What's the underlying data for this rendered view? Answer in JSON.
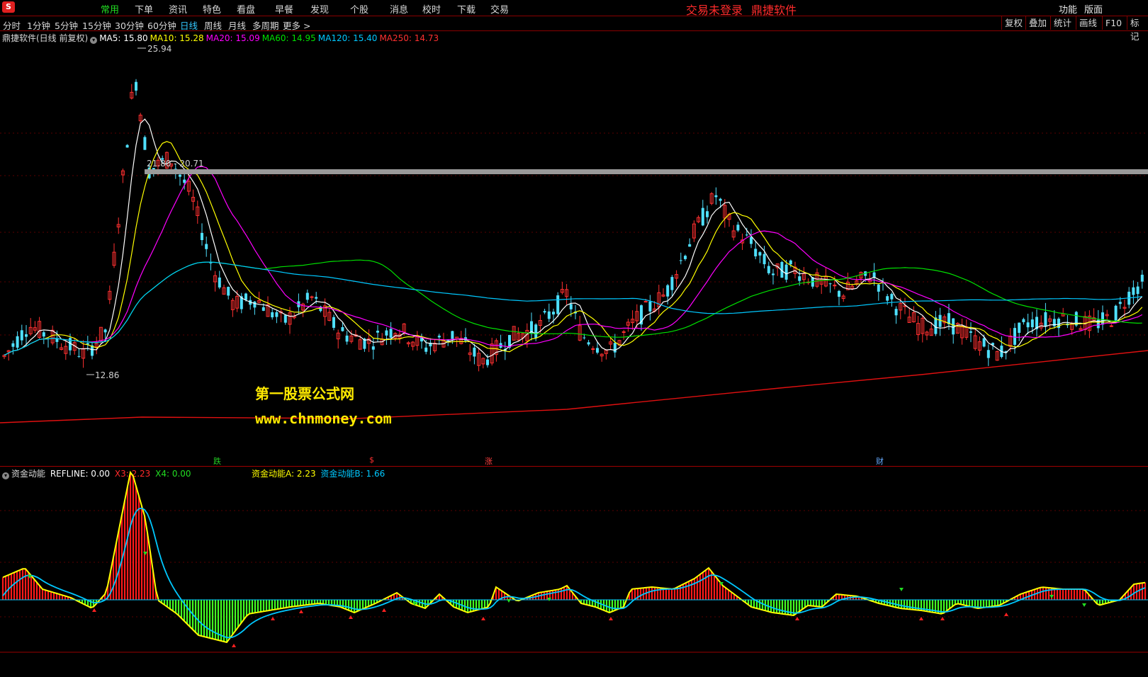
{
  "app": {
    "logo": "S"
  },
  "menu": [
    {
      "label": "常用",
      "active": true
    },
    {
      "label": "下单"
    },
    {
      "label": "资讯"
    },
    {
      "label": "特色"
    },
    {
      "label": "看盘"
    },
    {
      "label": "早餐"
    },
    {
      "label": "发现"
    },
    {
      "label": "个股"
    },
    {
      "label": "消息"
    },
    {
      "label": "校时"
    },
    {
      "label": "下载"
    },
    {
      "label": "交易"
    }
  ],
  "status": {
    "login": "交易未登录",
    "brand": "鼎捷软件"
  },
  "right_menu": [
    "功能",
    "版面"
  ],
  "periods": [
    "分时",
    "1分钟",
    "5分钟",
    "15分钟",
    "30分钟",
    "60分钟",
    "日线",
    "周线",
    "月线",
    "多周期",
    "更多 >"
  ],
  "active_period": "日线",
  "tools": [
    "复权",
    "叠加",
    "统计",
    "画线",
    "F10",
    "标记"
  ],
  "main_panel": {
    "title": "鼎捷软件(日线 前复权)",
    "ma": [
      {
        "label": "MA5: 15.80",
        "color": "#ffffff"
      },
      {
        "label": "MA10: 15.28",
        "color": "#ffff00"
      },
      {
        "label": "MA20: 15.09",
        "color": "#ff00ff"
      },
      {
        "label": "MA60: 14.95",
        "color": "#00e000"
      },
      {
        "label": "MA120: 15.40",
        "color": "#00c8ff"
      },
      {
        "label": "MA250: 14.73",
        "color": "#ff3030"
      }
    ],
    "high_label": "25.94",
    "low_label": "12.86",
    "range_label": "21.80 - 20.71"
  },
  "watermark": {
    "line1": "第一股票公式网",
    "line2": "www.chnmoney.com"
  },
  "events": [
    {
      "label": "跌",
      "color": "#22cc22"
    },
    {
      "label": "$",
      "color": "#ff3030"
    },
    {
      "label": "涨",
      "color": "#ff4040"
    },
    {
      "label": "财",
      "color": "#66aaff"
    }
  ],
  "sub_panel": {
    "title": "资金动能",
    "refline": "REFLINE: 0.00",
    "x3": "X3: 2.23",
    "x4": "X4: 0.00",
    "a": "资金动能A: 2.23",
    "b": "资金动能B: 1.66",
    "colors": {
      "refline": "#ffffff",
      "x3": "#ff2a2a",
      "x4": "#22dd22",
      "a": "#ffff00",
      "b": "#00c8ff"
    }
  }
}
